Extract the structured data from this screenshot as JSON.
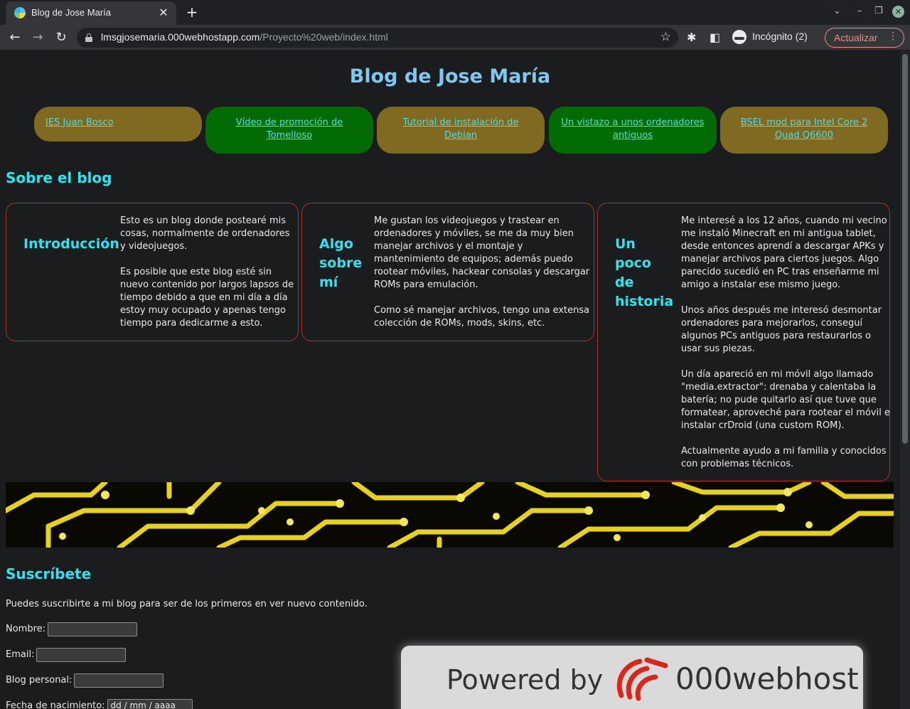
{
  "browser": {
    "tab_title": "Blog de Jose María",
    "new_tab_label": "+",
    "url_host": "lmsgjosemaria.000webhostapp.com",
    "url_path": "/Proyecto%20web/index.html",
    "incognito_label": "Incógnito (2)",
    "update_label": "Actualizar"
  },
  "page": {
    "site_title": "Blog de Jose María",
    "nav_links": [
      "IES Juan Bosco",
      "Vídeo de promoción de Tomelloso",
      "Tutorial de instalación de Debian",
      "Un vistazo a unos ordenadores antiguos",
      "BSEL mod para Intel Core 2 Quad Q6600"
    ],
    "about_heading": "Sobre el blog",
    "cards": [
      {
        "title": "Introducción",
        "text": "Esto es un blog donde postearé mis cosas, normalmente de ordenadores y videojuegos.\n\nEs posible que este blog esté sin nuevo contenido por largos lapsos de tiempo debido a que en mi día a día estoy muy ocupado y apenas tengo tiempo para dedicarme a esto."
      },
      {
        "title": "Algo sobre mí",
        "text": "Me gustan los videojuegos y trastear en ordenadores y móviles, se me da muy bien manejar archivos y el montaje y mantenimiento de equipos; además puedo rootear móviles, hackear consolas y descargar ROMs para emulación.\n\nComo sé manejar archivos, tengo una extensa colección de ROMs, mods, skins, etc."
      },
      {
        "title": "Un poco de historia",
        "text": "Me interesé a los 12 años, cuando mi vecino me instaló Minecraft en mi antigua tablet, desde entonces aprendí a descargar APKs y manejar archivos para ciertos juegos. Algo parecido sucedió en PC tras enseñarme mi amigo a instalar ese mismo juego.\n\nUnos años después me interesó desmontar ordenadores para mejorarlos, conseguí algunos PCs antiguos para restaurarlos o usar sus piezas.\n\nUn día apareció en mi móvil algo llamado \"media.extractor\": drenaba y calentaba la batería; no pude quitarlo así que tuve que formatear, aproveché para rootear el móvil e instalar crDroid (una custom ROM).\n\nActualmente ayudo a mi familia y conocidos con problemas técnicos."
      }
    ],
    "subscribe": {
      "heading": "Suscríbete",
      "intro": "Puedes suscribirte a mi blog para ser de los primeros en ver nuevo contenido.",
      "name_label": "Nombre:",
      "email_label": "Email:",
      "blog_label": "Blog personal:",
      "birth_label": "Fecha de nacimiento:",
      "birth_placeholder": "dd / mm / aaaa"
    },
    "badge": {
      "powered_text": "Powered by",
      "brand": "000webhost"
    }
  }
}
